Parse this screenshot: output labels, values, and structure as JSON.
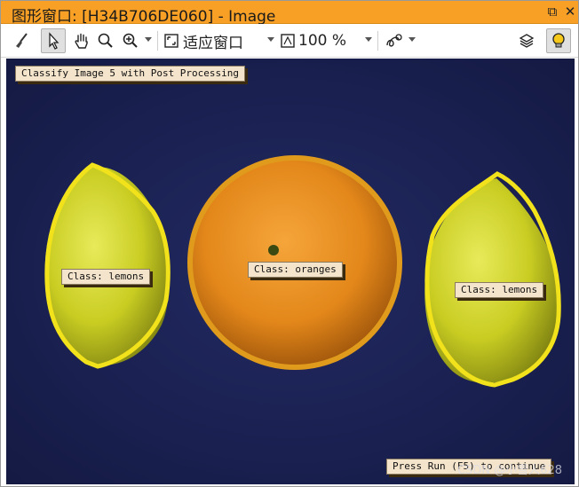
{
  "window": {
    "title": "图形窗口: [H34B706DE060] - Image",
    "restore_symbol": "⧉",
    "close_symbol": "✕"
  },
  "toolbar": {
    "fit_label": "适应窗口",
    "zoom_label": "100 %",
    "icons": [
      "broom-icon",
      "pointer-icon",
      "hand-icon",
      "magnifier-icon",
      "zoom-in-icon",
      "fit-window-icon",
      "zoom-percent-icon",
      "draw-icon",
      "layers-icon",
      "lightbulb-icon"
    ]
  },
  "image": {
    "header_label": "Classify Image 5 with Post Processing",
    "footer_label": "Press Run (F5) to continue",
    "detections": [
      {
        "class_text": "Class: lemons",
        "color": "#f2e21b"
      },
      {
        "class_text": "Class: oranges",
        "color": "#e09a1c"
      },
      {
        "class_text": "Class: lemons",
        "color": "#f2e21b"
      }
    ]
  },
  "watermark": "CSDN @小雪人628",
  "colors": {
    "titlebar": "#f7a025",
    "canvas_bg": "#1a2050",
    "lemon_outline": "#f2e21b",
    "orange_outline": "#e09a1c"
  }
}
